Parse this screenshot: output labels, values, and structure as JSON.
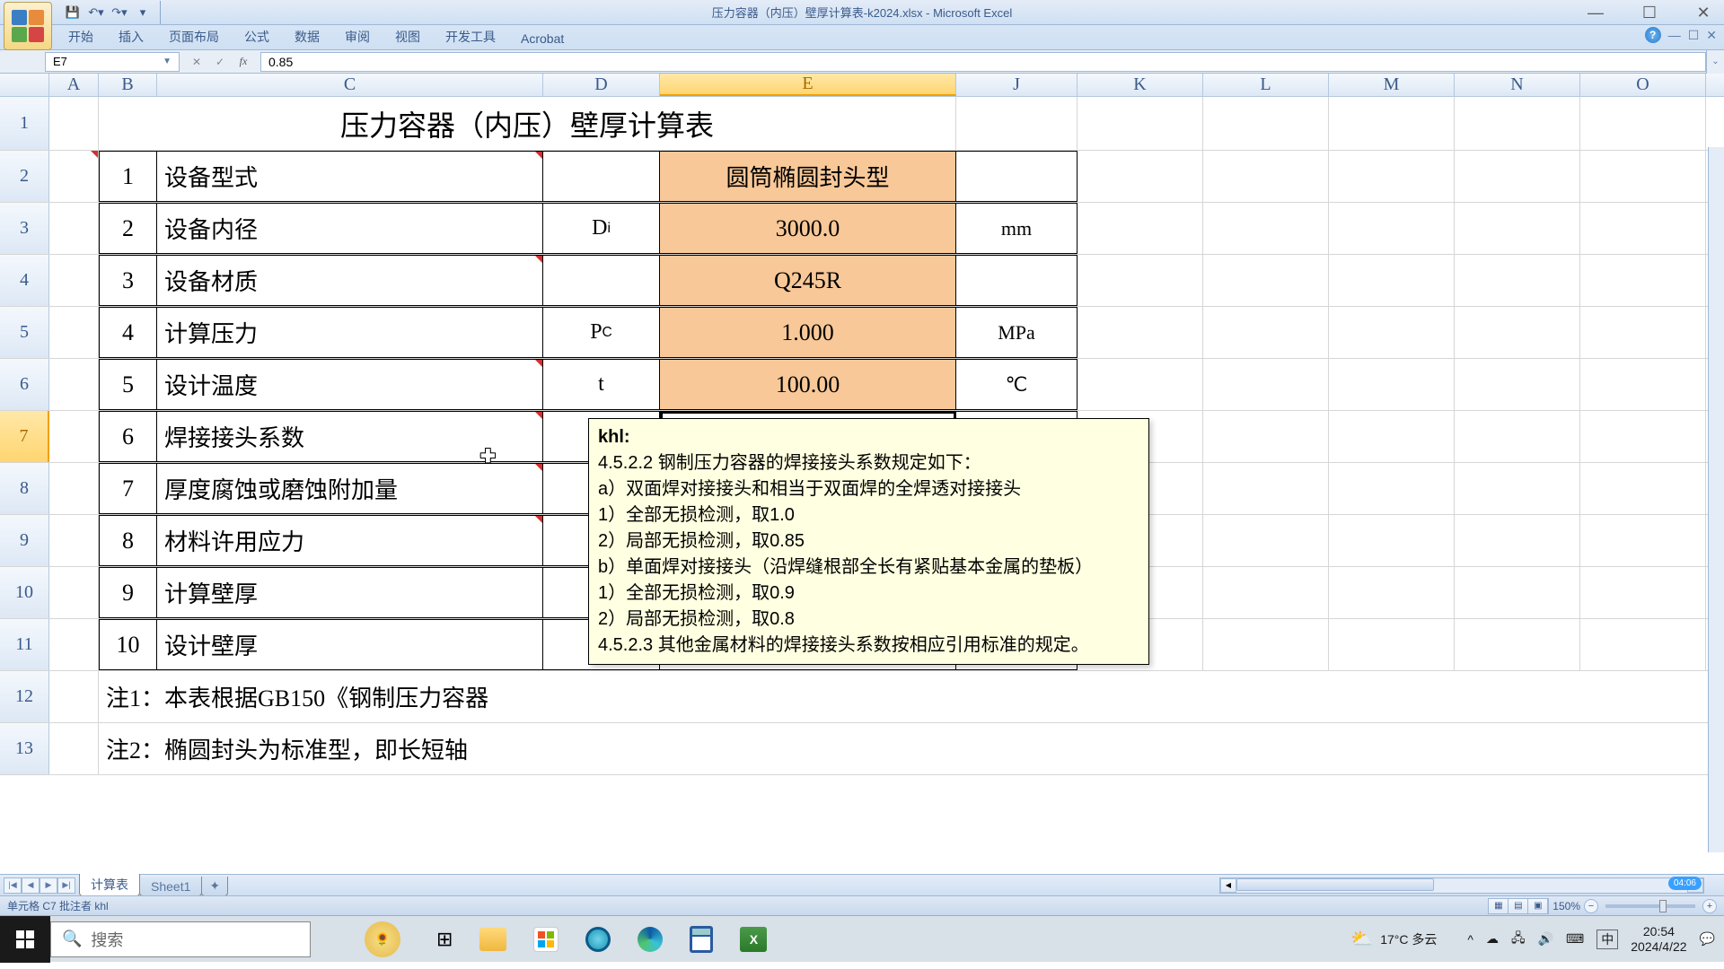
{
  "window": {
    "title": "压力容器（内压）壁厚计算表-k2024.xlsx - Microsoft Excel"
  },
  "ribbon": {
    "tabs": [
      "开始",
      "插入",
      "页面布局",
      "公式",
      "数据",
      "审阅",
      "视图",
      "开发工具",
      "Acrobat"
    ]
  },
  "formula_bar": {
    "name_box": "E7",
    "formula": "0.85"
  },
  "columns": [
    "A",
    "B",
    "C",
    "D",
    "E",
    "J",
    "K",
    "L",
    "M",
    "N",
    "O"
  ],
  "selected_col": "E",
  "row_headers": [
    "1",
    "2",
    "3",
    "4",
    "5",
    "6",
    "7",
    "8",
    "9",
    "10",
    "11",
    "12",
    "13"
  ],
  "selected_row": "7",
  "sheet": {
    "title": "压力容器（内压）壁厚计算表",
    "rows": [
      {
        "n": "1",
        "label": "设备型式",
        "sym": "",
        "val": "圆筒椭圆封头型",
        "unit": ""
      },
      {
        "n": "2",
        "label": "设备内径",
        "sym": "Di",
        "val": "3000.0",
        "unit": "mm"
      },
      {
        "n": "3",
        "label": "设备材质",
        "sym": "",
        "val": "Q245R",
        "unit": ""
      },
      {
        "n": "4",
        "label": "计算压力",
        "sym": "Pc",
        "val": "1.000",
        "unit": "MPa"
      },
      {
        "n": "5",
        "label": "设计温度",
        "sym": "t",
        "val": "100.00",
        "unit": "℃"
      },
      {
        "n": "6",
        "label": "焊接接头系数",
        "sym": "",
        "val": "",
        "unit": ""
      },
      {
        "n": "7",
        "label": "厚度腐蚀或磨蚀附加量",
        "sym": "",
        "val": "",
        "unit": ""
      },
      {
        "n": "8",
        "label": "材料许用应力",
        "sym": "",
        "val": "",
        "unit": ""
      },
      {
        "n": "9",
        "label": "计算壁厚",
        "sym": "",
        "val": "",
        "unit": ""
      },
      {
        "n": "10",
        "label": "设计壁厚",
        "sym": "",
        "val": "",
        "unit": ""
      }
    ],
    "note1": "注1：本表根据GB150《钢制压力容器",
    "note2": "注2：椭圆封头为标准型，即长短轴"
  },
  "comment": {
    "author": "khl:",
    "lines": [
      "4.5.2.2 钢制压力容器的焊接接头系数规定如下：",
      "a）双面焊对接接头和相当于双面焊的全焊透对接接头",
      "1）全部无损检测，取1.0",
      "2）局部无损检测，取0.85",
      "b）单面焊对接接头（沿焊缝根部全长有紧贴基本金属的垫板）",
      "1）全部无损检测，取0.9",
      "2）局部无损检测，取0.8",
      "4.5.2.3 其他金属材料的焊接接头系数按相应引用标准的规定。"
    ]
  },
  "sheet_tabs": {
    "active": "计算表",
    "others": [
      "Sheet1"
    ]
  },
  "status": {
    "text": "单元格 C7 批注者 khl",
    "zoom": "150%"
  },
  "time_badge": "04:06",
  "taskbar": {
    "search_placeholder": "搜索",
    "weather": "17°C 多云",
    "ime": "中",
    "time": "20:54",
    "date": "2024/4/22"
  }
}
